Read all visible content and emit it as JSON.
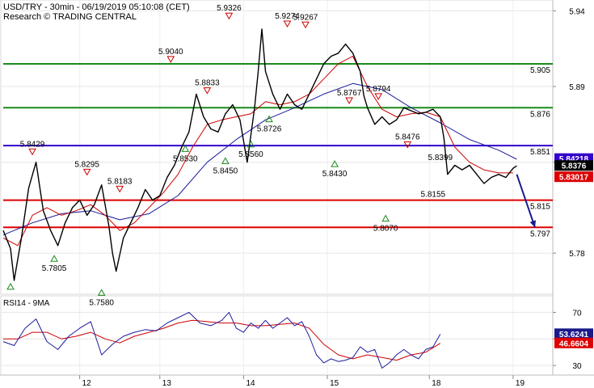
{
  "header": {
    "title": "USD/TRY - 30min - 06/19/2019 05:10:08 (CET)",
    "source": "Research © TRADING CENTRAL"
  },
  "colors": {
    "price": "#000000",
    "ma_fast": "#cc0000",
    "ma_slow": "#1a1a9c",
    "resistance": "#1a8a1a",
    "support": "#dd0000",
    "pivot": "#3300cc",
    "arrow": "#1a1a8c"
  },
  "chart_data": [
    {
      "type": "line",
      "panel": "price",
      "ylim": [
        5.755,
        5.945
      ],
      "yticks": [
        5.78,
        5.84,
        5.89,
        5.94
      ],
      "x_day_labels": [
        {
          "label": "12",
          "bar": 21
        },
        {
          "label": "13",
          "bar": 43
        },
        {
          "label": "14",
          "bar": 66
        },
        {
          "label": "15",
          "bar": 89
        },
        {
          "label": "18",
          "bar": 117
        },
        {
          "label": "19",
          "bar": 140
        }
      ],
      "levels": [
        {
          "value": 5.905,
          "label": "5.905",
          "kind": "resistance"
        },
        {
          "value": 5.876,
          "label": "5.876",
          "kind": "resistance"
        },
        {
          "value": 5.851,
          "label": "5.851",
          "kind": "pivot"
        },
        {
          "value": 5.815,
          "label": "5.815",
          "kind": "support"
        },
        {
          "value": 5.797,
          "label": "5.797",
          "kind": "support"
        }
      ],
      "price_tags": [
        {
          "value": 5.84218,
          "label": "5.84218",
          "bg": "#3300cc"
        },
        {
          "value": 5.8376,
          "label": "5.8376",
          "bg": "#000000"
        },
        {
          "value": 5.83017,
          "label": "5.83017",
          "bg": "#dd0000"
        }
      ],
      "series": [
        {
          "key": "price",
          "points": [
            [
              0,
              5.795
            ],
            [
              2,
              5.783
            ],
            [
              3,
              5.762
            ],
            [
              5,
              5.79
            ],
            [
              7,
              5.823
            ],
            [
              9,
              5.84
            ],
            [
              11,
              5.808
            ],
            [
              13,
              5.795
            ],
            [
              15,
              5.785
            ],
            [
              17,
              5.8
            ],
            [
              19,
              5.81
            ],
            [
              21,
              5.815
            ],
            [
              23,
              5.805
            ],
            [
              25,
              5.812
            ],
            [
              27,
              5.825
            ],
            [
              29,
              5.798
            ],
            [
              30,
              5.78
            ],
            [
              31,
              5.768
            ],
            [
              33,
              5.79
            ],
            [
              35,
              5.8
            ],
            [
              37,
              5.81
            ],
            [
              39,
              5.822
            ],
            [
              41,
              5.815
            ],
            [
              43,
              5.818
            ],
            [
              45,
              5.83
            ],
            [
              47,
              5.838
            ],
            [
              49,
              5.85
            ],
            [
              51,
              5.86
            ],
            [
              53,
              5.885
            ],
            [
              55,
              5.87
            ],
            [
              57,
              5.862
            ],
            [
              59,
              5.86
            ],
            [
              61,
              5.872
            ],
            [
              63,
              5.878
            ],
            [
              65,
              5.868
            ],
            [
              67,
              5.84
            ],
            [
              69,
              5.876
            ],
            [
              70,
              5.9
            ],
            [
              71,
              5.928
            ],
            [
              72,
              5.9
            ],
            [
              74,
              5.885
            ],
            [
              76,
              5.875
            ],
            [
              78,
              5.885
            ],
            [
              80,
              5.878
            ],
            [
              82,
              5.875
            ],
            [
              84,
              5.885
            ],
            [
              86,
              5.895
            ],
            [
              88,
              5.905
            ],
            [
              90,
              5.91
            ],
            [
              92,
              5.912
            ],
            [
              94,
              5.918
            ],
            [
              96,
              5.912
            ],
            [
              98,
              5.9
            ],
            [
              99,
              5.884
            ],
            [
              100,
              5.876
            ],
            [
              102,
              5.865
            ],
            [
              104,
              5.87
            ],
            [
              106,
              5.865
            ],
            [
              108,
              5.868
            ],
            [
              110,
              5.876
            ],
            [
              112,
              5.874
            ],
            [
              114,
              5.872
            ],
            [
              116,
              5.873
            ],
            [
              118,
              5.875
            ],
            [
              120,
              5.87
            ],
            [
              121,
              5.856
            ],
            [
              122,
              5.832
            ],
            [
              124,
              5.838
            ],
            [
              126,
              5.835
            ],
            [
              128,
              5.838
            ],
            [
              130,
              5.832
            ],
            [
              132,
              5.826
            ],
            [
              134,
              5.83
            ],
            [
              136,
              5.832
            ],
            [
              138,
              5.83
            ],
            [
              140,
              5.836
            ],
            [
              141,
              5.8376
            ]
          ]
        },
        {
          "key": "ma_fast",
          "points": [
            [
              0,
              5.79
            ],
            [
              4,
              5.785
            ],
            [
              8,
              5.805
            ],
            [
              12,
              5.81
            ],
            [
              16,
              5.805
            ],
            [
              20,
              5.808
            ],
            [
              24,
              5.812
            ],
            [
              28,
              5.805
            ],
            [
              32,
              5.795
            ],
            [
              36,
              5.8
            ],
            [
              40,
              5.81
            ],
            [
              44,
              5.82
            ],
            [
              48,
              5.832
            ],
            [
              52,
              5.85
            ],
            [
              56,
              5.865
            ],
            [
              60,
              5.868
            ],
            [
              64,
              5.87
            ],
            [
              68,
              5.872
            ],
            [
              72,
              5.88
            ],
            [
              76,
              5.878
            ],
            [
              80,
              5.88
            ],
            [
              84,
              5.885
            ],
            [
              88,
              5.895
            ],
            [
              92,
              5.905
            ],
            [
              96,
              5.91
            ],
            [
              100,
              5.89
            ],
            [
              104,
              5.875
            ],
            [
              108,
              5.87
            ],
            [
              112,
              5.872
            ],
            [
              116,
              5.873
            ],
            [
              120,
              5.87
            ],
            [
              124,
              5.85
            ],
            [
              128,
              5.84
            ],
            [
              132,
              5.835
            ],
            [
              136,
              5.833
            ],
            [
              140,
              5.833
            ]
          ]
        },
        {
          "key": "ma_slow",
          "points": [
            [
              0,
              5.792
            ],
            [
              8,
              5.8
            ],
            [
              16,
              5.806
            ],
            [
              24,
              5.808
            ],
            [
              32,
              5.802
            ],
            [
              40,
              5.806
            ],
            [
              48,
              5.818
            ],
            [
              56,
              5.84
            ],
            [
              64,
              5.855
            ],
            [
              72,
              5.868
            ],
            [
              80,
              5.876
            ],
            [
              88,
              5.885
            ],
            [
              96,
              5.892
            ],
            [
              104,
              5.888
            ],
            [
              112,
              5.876
            ],
            [
              120,
              5.866
            ],
            [
              128,
              5.855
            ],
            [
              136,
              5.848
            ],
            [
              141,
              5.842
            ]
          ]
        }
      ],
      "annotations": [
        {
          "bar": 8,
          "value": 5.8429,
          "label": "5.8429",
          "marker": "down"
        },
        {
          "bar": 2,
          "value": 5.762,
          "label": "",
          "marker": "up"
        },
        {
          "bar": 14,
          "value": 5.7805,
          "label": "5.7805",
          "marker": "up"
        },
        {
          "bar": 23,
          "value": 5.8295,
          "label": "5.8295",
          "marker": "down"
        },
        {
          "bar": 27,
          "value": 5.758,
          "label": "5.7580",
          "marker": "up"
        },
        {
          "bar": 32,
          "value": 5.8183,
          "label": "5.8183",
          "marker": "down"
        },
        {
          "bar": 46,
          "value": 5.904,
          "label": "5.9040",
          "marker": "down"
        },
        {
          "bar": 50,
          "value": 5.853,
          "label": "5.8530",
          "marker": "up"
        },
        {
          "bar": 56,
          "value": 5.8833,
          "label": "5.8833",
          "marker": "down"
        },
        {
          "bar": 61,
          "value": 5.845,
          "label": "5.8450",
          "marker": "up"
        },
        {
          "bar": 62,
          "value": 5.9326,
          "label": "5.9326",
          "marker": "down"
        },
        {
          "bar": 68,
          "value": 5.856,
          "label": "5.8560",
          "marker": "up"
        },
        {
          "bar": 73,
          "value": 5.8726,
          "label": "5.8726",
          "marker": "up"
        },
        {
          "bar": 78,
          "value": 5.9274,
          "label": "5.9274",
          "marker": "down"
        },
        {
          "bar": 83,
          "value": 5.9267,
          "label": "5.9267",
          "marker": "down"
        },
        {
          "bar": 91,
          "value": 5.843,
          "label": "5.8430",
          "marker": "up"
        },
        {
          "bar": 95,
          "value": 5.8767,
          "label": "5.8767",
          "marker": "down"
        },
        {
          "bar": 103,
          "value": 5.8794,
          "label": "5.8794",
          "marker": "down"
        },
        {
          "bar": 105,
          "value": 5.807,
          "label": "5.8070",
          "marker": "up"
        },
        {
          "bar": 111,
          "value": 5.8476,
          "label": "5.8476",
          "marker": "down"
        },
        {
          "bar": 118,
          "value": 5.8155,
          "label": "5.8155",
          "marker": "none"
        },
        {
          "bar": 120,
          "value": 5.8399,
          "label": "5.8399",
          "marker": "none"
        }
      ],
      "forecast_arrow": {
        "from": [
          141,
          5.832
        ],
        "to": [
          146,
          5.797
        ]
      }
    },
    {
      "type": "line",
      "panel": "rsi",
      "title": "RSI14 - 9MA",
      "ylim": [
        24,
        80
      ],
      "yticks": [
        30,
        50,
        70
      ],
      "price_tags": [
        {
          "value": 53.6241,
          "label": "53.6241",
          "bg": "#1a1a8c"
        },
        {
          "value": 46.6604,
          "label": "46.6604",
          "bg": "#dd0000"
        }
      ],
      "series": [
        {
          "key": "rsi",
          "points": [
            [
              0,
              48
            ],
            [
              3,
              45
            ],
            [
              6,
              58
            ],
            [
              9,
              65
            ],
            [
              12,
              48
            ],
            [
              15,
              42
            ],
            [
              18,
              52
            ],
            [
              21,
              58
            ],
            [
              24,
              63
            ],
            [
              27,
              38
            ],
            [
              30,
              46
            ],
            [
              33,
              52
            ],
            [
              36,
              55
            ],
            [
              39,
              57
            ],
            [
              42,
              56
            ],
            [
              45,
              62
            ],
            [
              48,
              66
            ],
            [
              51,
              70
            ],
            [
              54,
              62
            ],
            [
              57,
              60
            ],
            [
              60,
              64
            ],
            [
              62,
              70
            ],
            [
              64,
              58
            ],
            [
              66,
              55
            ],
            [
              68,
              62
            ],
            [
              70,
              58
            ],
            [
              72,
              64
            ],
            [
              74,
              58
            ],
            [
              76,
              62
            ],
            [
              78,
              66
            ],
            [
              80,
              60
            ],
            [
              82,
              63
            ],
            [
              84,
              52
            ],
            [
              86,
              38
            ],
            [
              88,
              32
            ],
            [
              90,
              35
            ],
            [
              92,
              33
            ],
            [
              94,
              34
            ],
            [
              96,
              36
            ],
            [
              98,
              44
            ],
            [
              100,
              40
            ],
            [
              102,
              42
            ],
            [
              104,
              28
            ],
            [
              106,
              32
            ],
            [
              108,
              38
            ],
            [
              110,
              42
            ],
            [
              112,
              38
            ],
            [
              114,
              35
            ],
            [
              116,
              42
            ],
            [
              118,
              44
            ],
            [
              120,
              53.6
            ]
          ]
        },
        {
          "key": "rsi_ma",
          "points": [
            [
              0,
              50
            ],
            [
              4,
              50
            ],
            [
              8,
              55
            ],
            [
              12,
              55
            ],
            [
              16,
              50
            ],
            [
              20,
              52
            ],
            [
              24,
              55
            ],
            [
              28,
              50
            ],
            [
              32,
              47
            ],
            [
              36,
              52
            ],
            [
              40,
              55
            ],
            [
              44,
              58
            ],
            [
              48,
              62
            ],
            [
              52,
              64
            ],
            [
              56,
              63
            ],
            [
              60,
              62
            ],
            [
              64,
              62
            ],
            [
              68,
              60
            ],
            [
              72,
              60
            ],
            [
              76,
              61
            ],
            [
              80,
              62
            ],
            [
              84,
              58
            ],
            [
              88,
              46
            ],
            [
              92,
              38
            ],
            [
              96,
              35
            ],
            [
              100,
              38
            ],
            [
              104,
              36
            ],
            [
              108,
              34
            ],
            [
              112,
              38
            ],
            [
              116,
              40
            ],
            [
              120,
              46.7
            ]
          ]
        }
      ]
    }
  ]
}
